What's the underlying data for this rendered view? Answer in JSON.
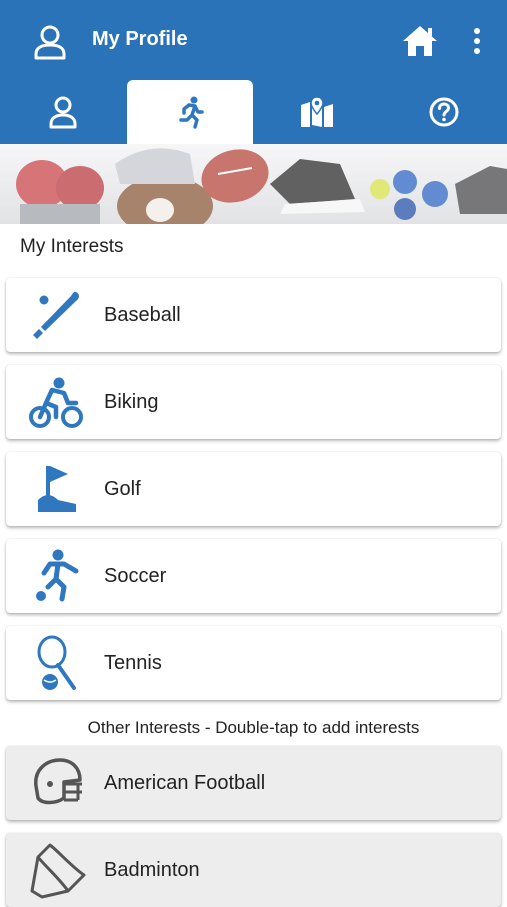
{
  "header": {
    "title": "My Profile",
    "profile_icon": "person-outline-icon",
    "home_icon": "home-icon",
    "menu_icon": "more-vertical-icon"
  },
  "tabs": [
    {
      "name": "profile",
      "icon": "person-icon",
      "active": false
    },
    {
      "name": "interests",
      "icon": "running-person-icon",
      "active": true
    },
    {
      "name": "map",
      "icon": "map-location-icon",
      "active": false
    },
    {
      "name": "help",
      "icon": "help-circle-icon",
      "active": false
    }
  ],
  "my_interests": {
    "title": "My Interests",
    "items": [
      {
        "label": "Baseball",
        "icon": "baseball-bat-icon"
      },
      {
        "label": "Biking",
        "icon": "cyclist-icon"
      },
      {
        "label": "Golf",
        "icon": "golf-flag-icon"
      },
      {
        "label": "Soccer",
        "icon": "soccer-player-icon"
      },
      {
        "label": "Tennis",
        "icon": "tennis-racket-icon"
      }
    ]
  },
  "other_interests": {
    "title": "Other Interests - Double-tap to add interests",
    "items": [
      {
        "label": "American Football",
        "icon": "football-helmet-icon"
      },
      {
        "label": "Badminton",
        "icon": "shuttlecock-icon"
      }
    ]
  },
  "colors": {
    "primary": "#2b73b8",
    "icon_blue": "#2f78c0"
  }
}
